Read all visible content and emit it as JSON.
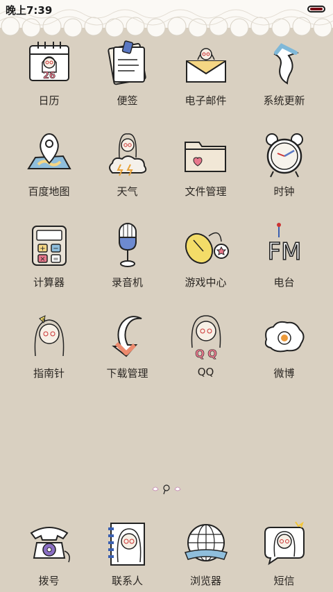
{
  "status_bar": {
    "time": "晚上7:39",
    "battery_color": "#7a0a14"
  },
  "background_color": "#d9d0c1",
  "apps": [
    {
      "label": "日历",
      "icon": "calendar-icon"
    },
    {
      "label": "便签",
      "icon": "notepad-icon"
    },
    {
      "label": "电子邮件",
      "icon": "email-icon"
    },
    {
      "label": "系统更新",
      "icon": "update-arrow-icon"
    },
    {
      "label": "百度地图",
      "icon": "map-pin-icon"
    },
    {
      "label": "天气",
      "icon": "weather-cloud-icon"
    },
    {
      "label": "文件管理",
      "icon": "folder-icon"
    },
    {
      "label": "时钟",
      "icon": "alarm-clock-icon"
    },
    {
      "label": "计算器",
      "icon": "calculator-icon"
    },
    {
      "label": "录音机",
      "icon": "microphone-icon"
    },
    {
      "label": "游戏中心",
      "icon": "game-mouse-icon"
    },
    {
      "label": "电台",
      "icon": "fm-radio-icon"
    },
    {
      "label": "指南针",
      "icon": "compass-girl-icon"
    },
    {
      "label": "下载管理",
      "icon": "download-arrow-icon"
    },
    {
      "label": "QQ",
      "icon": "qq-girl-icon"
    },
    {
      "label": "微博",
      "icon": "egg-weibo-icon"
    }
  ],
  "dock": [
    {
      "label": "拨号",
      "icon": "telephone-icon"
    },
    {
      "label": "联系人",
      "icon": "contacts-book-icon"
    },
    {
      "label": "浏览器",
      "icon": "globe-icon"
    },
    {
      "label": "短信",
      "icon": "message-bubble-icon"
    }
  ]
}
